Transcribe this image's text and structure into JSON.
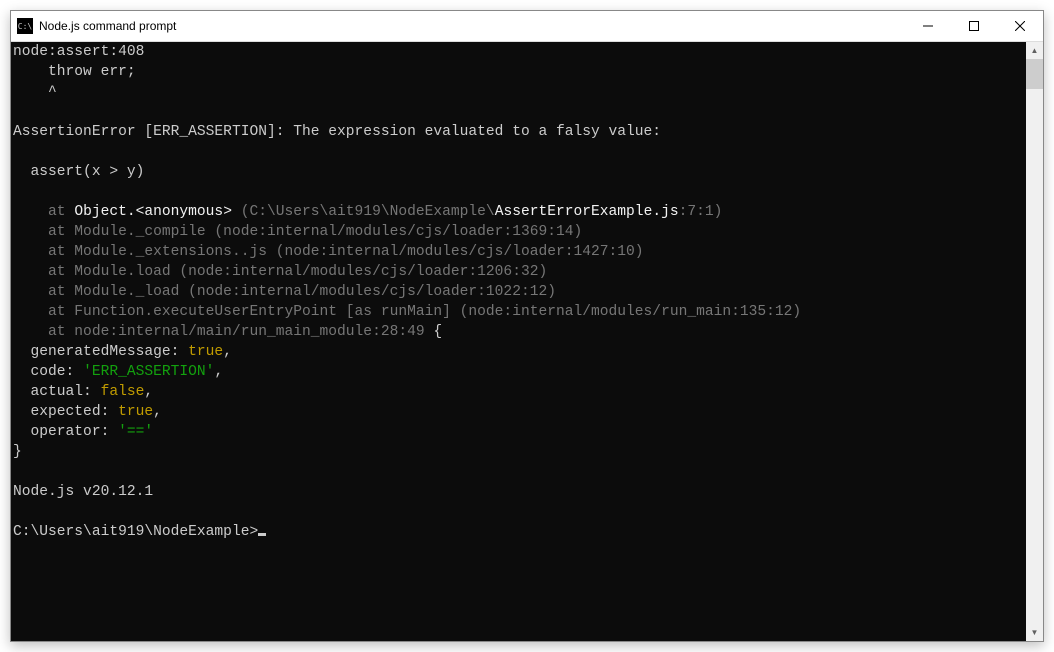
{
  "window": {
    "title": "Node.js command prompt"
  },
  "output": {
    "l1": "node:assert:408",
    "l2": "    throw err;",
    "l3": "    ^",
    "l4": "",
    "l5": "AssertionError [ERR_ASSERTION]: The expression evaluated to a falsy value:",
    "l6": "",
    "l7": "  assert(x > y)",
    "l8": "",
    "st1a": "    at ",
    "st1b": "Object.<anonymous>",
    "st1c": " (",
    "st1d": "C:\\Users\\ait919\\NodeExample\\",
    "st1e": "AssertErrorExample.js",
    "st1f": ":7:1",
    "st1g": ")",
    "st2": "    at Module._compile (node:internal/modules/cjs/loader:1369:14)",
    "st3": "    at Module._extensions..js (node:internal/modules/cjs/loader:1427:10)",
    "st4": "    at Module.load (node:internal/modules/cjs/loader:1206:32)",
    "st5": "    at Module._load (node:internal/modules/cjs/loader:1022:12)",
    "st6": "    at Function.executeUserEntryPoint [as runMain] (node:internal/modules/run_main:135:12)",
    "st7": "    at node:internal/main/run_main_module:28:49",
    "brace_open": " {",
    "p1k": "  generatedMessage: ",
    "p1v": "true",
    "p2k": "  code: ",
    "p2v": "'ERR_ASSERTION'",
    "p3k": "  actual: ",
    "p3v": "false",
    "p4k": "  expected: ",
    "p4v": "true",
    "p5k": "  operator: ",
    "p5v": "'=='",
    "brace_close": "}",
    "comma": ",",
    "blank": "",
    "version": "Node.js v20.12.1",
    "prompt": "C:\\Users\\ait919\\NodeExample>"
  }
}
